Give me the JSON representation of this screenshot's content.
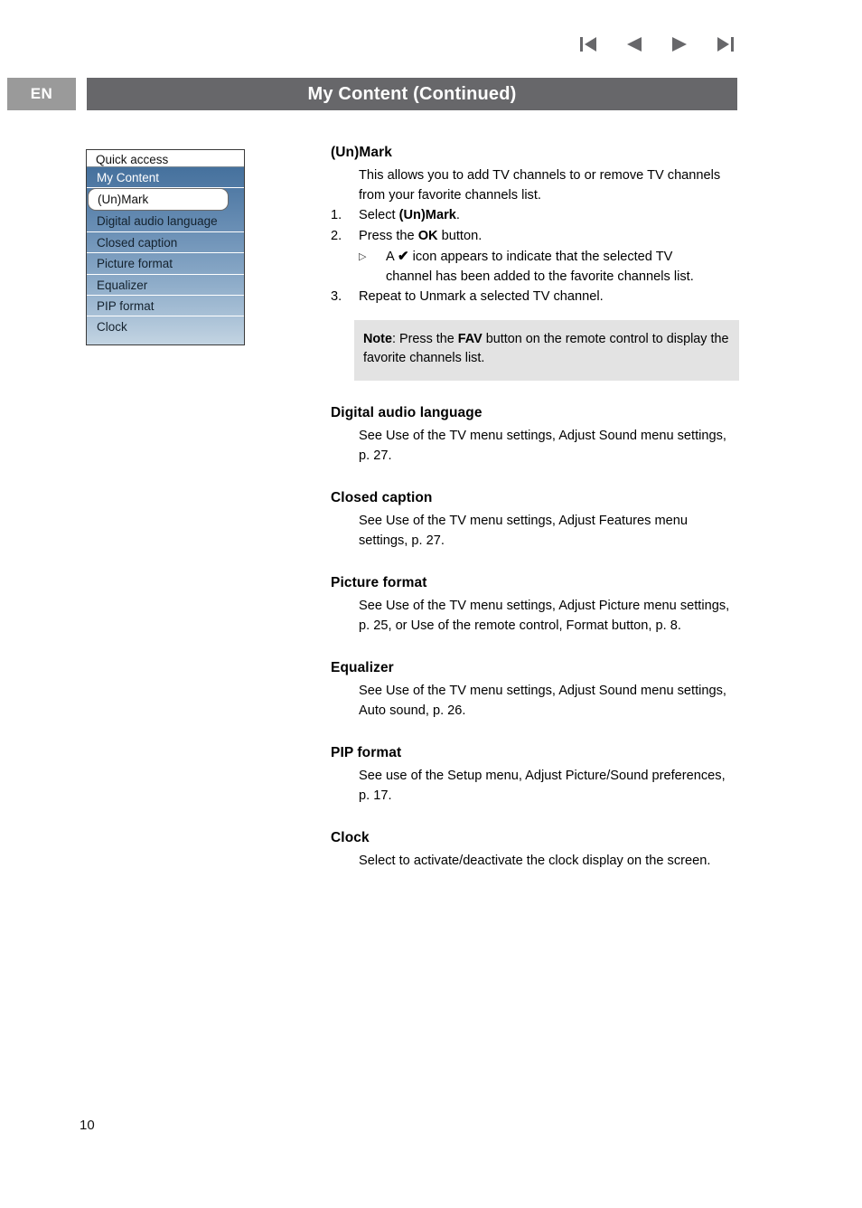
{
  "nav": {
    "buttons": [
      {
        "name": "first-page-icon",
        "label": "First page"
      },
      {
        "name": "previous-page-icon",
        "label": "Previous page"
      },
      {
        "name": "next-page-icon",
        "label": "Next page"
      },
      {
        "name": "last-page-icon",
        "label": "Last page"
      }
    ],
    "color": "#67676a"
  },
  "header": {
    "language_badge": "EN",
    "title": "My Content  (Continued)",
    "badge_color": "#9a9a9a",
    "bar_color": "#67676a"
  },
  "osd_menu": {
    "title": "Quick access",
    "items": [
      {
        "label": "My Content",
        "state": "selected"
      },
      {
        "label": "(Un)Mark",
        "state": "focused"
      },
      {
        "label": "Digital audio language",
        "state": "normal"
      },
      {
        "label": "Closed caption",
        "state": "normal"
      },
      {
        "label": "Picture format",
        "state": "normal"
      },
      {
        "label": "Equalizer",
        "state": "normal"
      },
      {
        "label": "PIP format",
        "state": "normal"
      },
      {
        "label": "Clock",
        "state": "normal"
      }
    ],
    "gradient_top": "#3c6a98",
    "gradient_bottom": "#c3d4e2"
  },
  "content": {
    "unmark": {
      "heading": "(Un)Mark",
      "intro": "This allows you to add TV channels to or remove TV channels from your favorite channels list.",
      "steps": [
        {
          "num": "1.",
          "pre": "Select ",
          "bold": "(Un)Mark",
          "post": "."
        },
        {
          "num": "2.",
          "pre": "Press the ",
          "bold": "OK",
          "post": " button."
        },
        {
          "num": "3.",
          "pre": "Repeat to Unmark a selected TV channel.",
          "bold": "",
          "post": ""
        }
      ],
      "substep": {
        "bullet": "▷",
        "pre": "A ",
        "check": "✔",
        "post": " icon appears to indicate that the selected TV",
        "line2": "channel has been added to the favorite channels list."
      },
      "note": {
        "label": "Note",
        "sep": ": Press the ",
        "bold": "FAV",
        "rest": " button on the remote control to display the favorite channels list.",
        "background": "#e3e3e3"
      }
    },
    "sections": [
      {
        "heading": "Digital audio language",
        "body": "See Use of the TV menu settings, Adjust Sound menu settings, p. 27."
      },
      {
        "heading": "Closed caption",
        "body": "See Use of the TV menu settings, Adjust Features menu settings, p. 27."
      },
      {
        "heading": "Picture format",
        "body": "See Use of the TV menu settings, Adjust Picture menu settings, p. 25, or Use of the remote control, Format button, p. 8."
      },
      {
        "heading": "Equalizer",
        "body": "See Use of the TV menu settings, Adjust Sound menu settings, Auto sound, p. 26."
      },
      {
        "heading": "PIP format",
        "body": "See use of the Setup menu, Adjust Picture/Sound preferences, p. 17."
      },
      {
        "heading": "Clock",
        "body": "Select to activate/deactivate the clock display on the screen."
      }
    ]
  },
  "footer": {
    "page_number": "10"
  }
}
